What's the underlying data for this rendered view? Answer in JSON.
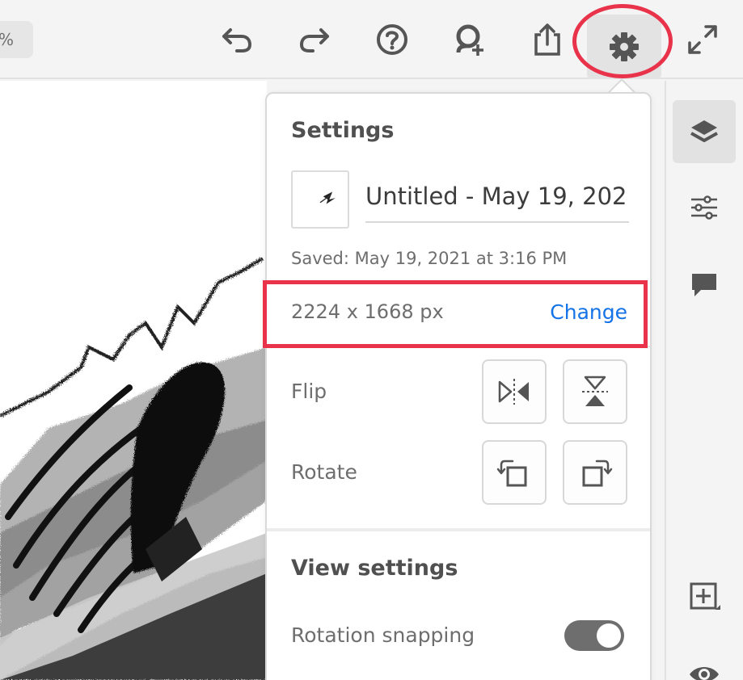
{
  "toolbar": {
    "zoom_text": "%",
    "buttons": [
      "undo-icon",
      "redo-icon",
      "help-icon",
      "invite-icon",
      "share-icon",
      "gear-icon",
      "fullscreen-icon"
    ]
  },
  "settings": {
    "title": "Settings",
    "document_name": "Untitled - May 19, 202…",
    "saved": "Saved: May 19, 2021 at 3:16 PM",
    "canvas_size": "2224 x 1668 px",
    "change_label": "Change",
    "flip_label": "Flip",
    "rotate_label": "Rotate",
    "view_settings_title": "View settings",
    "rotation_snapping_label": "Rotation snapping",
    "rotation_snapping_on": true
  },
  "rail": {
    "items": [
      "layers-icon",
      "adjustments-icon",
      "comment-icon",
      "add-layer-icon",
      "eye-icon"
    ]
  },
  "colors": {
    "highlight": "#e8334a",
    "link": "#1473e6",
    "toggle_on": "#6e6e6e"
  }
}
